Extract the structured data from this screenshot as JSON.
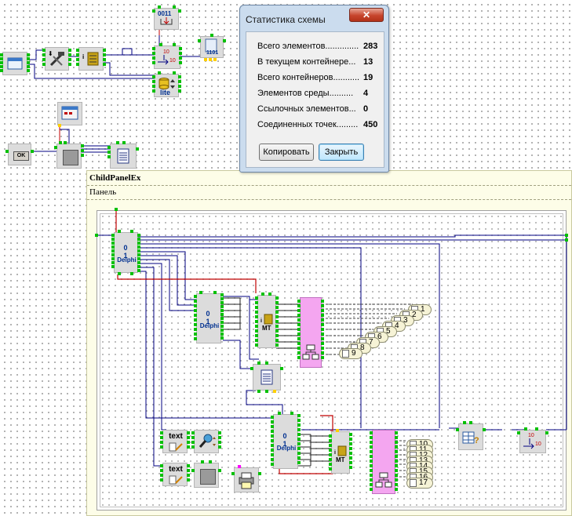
{
  "panel": {
    "title": "ChildPanelEx",
    "subtitle": "Панель"
  },
  "dialog": {
    "title": "Статистика схемы",
    "close_glyph": "✕",
    "stats": [
      {
        "label": "Всего элементов..............",
        "value": "283"
      },
      {
        "label": "В текущем контейнере...",
        "value": "13"
      },
      {
        "label": "Всего контейнеров...........",
        "value": "19"
      },
      {
        "label": "Элементов среды..........",
        "value": "4"
      },
      {
        "label": "Ссылочных элементов...",
        "value": "0"
      },
      {
        "label": "Соединенных точек.........",
        "value": "450"
      }
    ],
    "copy_label": "Копировать",
    "close_label": "Закрыть"
  },
  "nodes": {
    "delphi_label": "Delphi",
    "mt_label": "MT",
    "lite_label": "lite",
    "ok_label": "OK",
    "text_label": "text",
    "bits_label": "0011",
    "bits2_label": "1101",
    "ten_label": "10",
    "i_label": "i",
    "zero_one": "0\n1"
  },
  "outputs_top": [
    "1",
    "2",
    "3",
    "4",
    "5",
    "6",
    "7",
    "8",
    "9"
  ],
  "outputs_bottom": [
    "10",
    "11",
    "12",
    "13",
    "14",
    "15",
    "16",
    "17"
  ],
  "colors": {
    "wire_navy": "#000080",
    "wire_red": "#c00000",
    "wire_black": "#202020",
    "pin_green": "#00c000",
    "hub_pink": "#f4a6f0"
  }
}
